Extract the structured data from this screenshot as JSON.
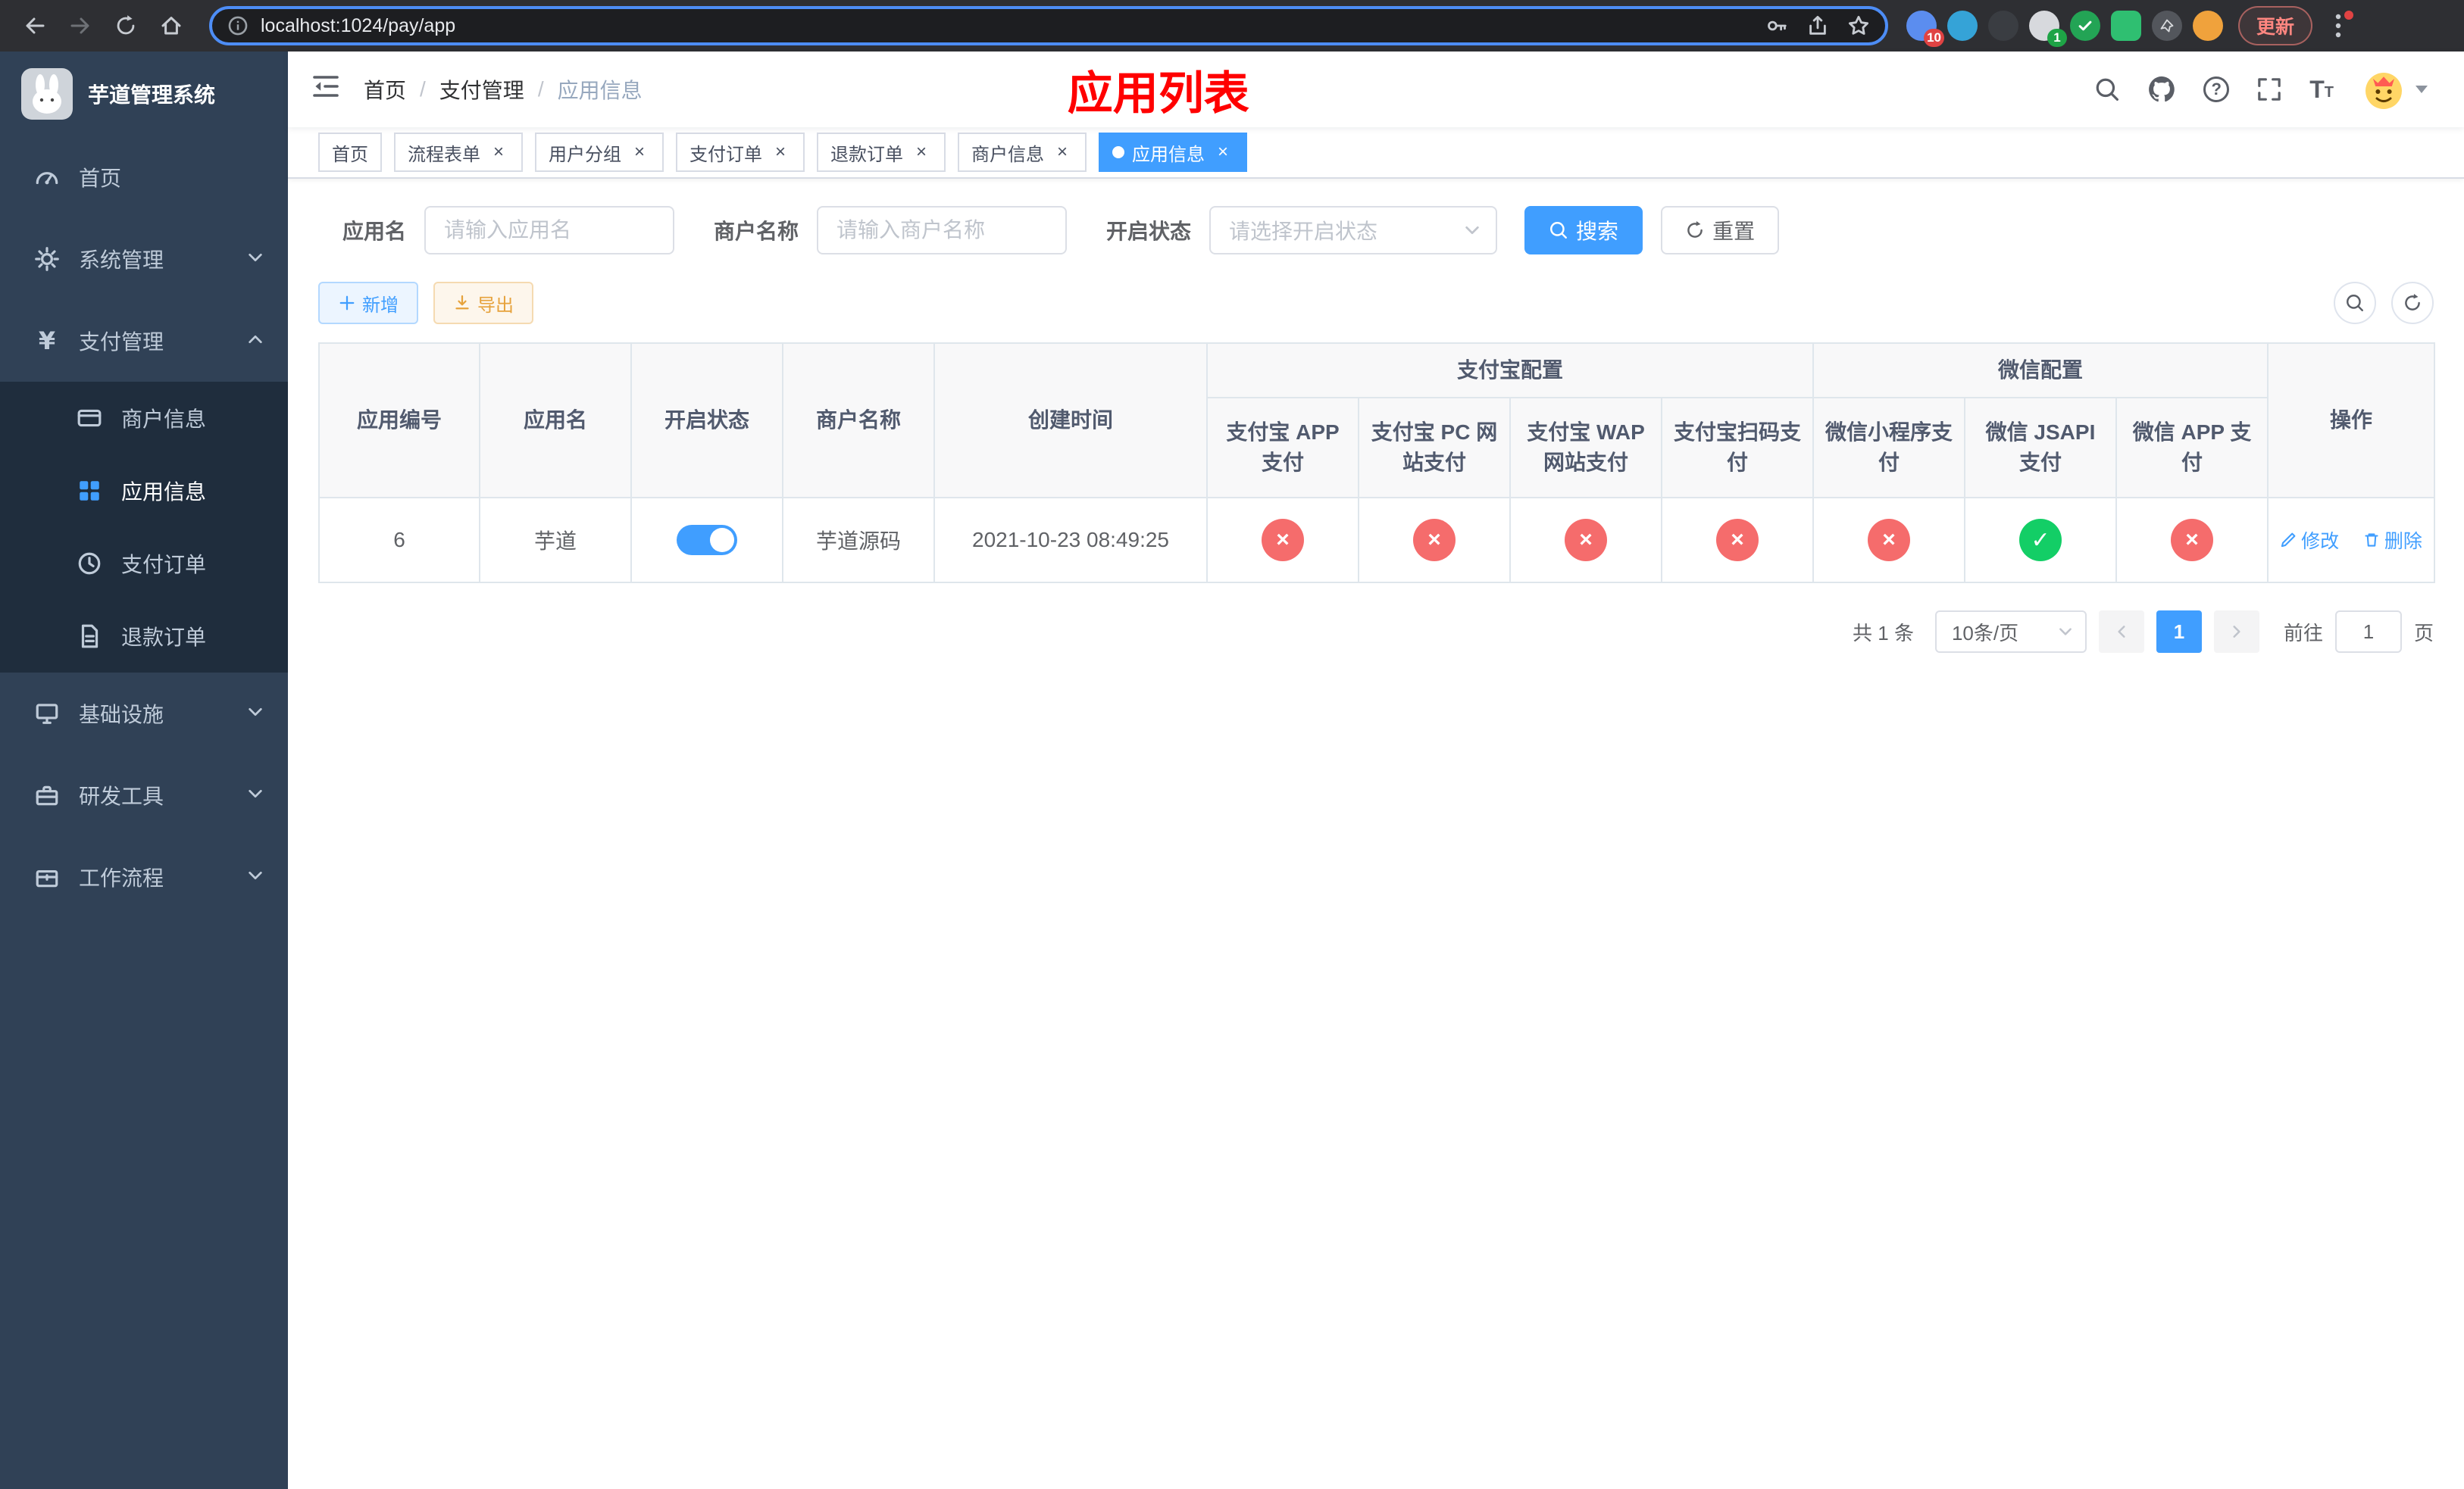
{
  "browser": {
    "url": "localhost:1024/pay/app",
    "update_label": "更新",
    "extension_badge_1": "10",
    "extension_badge_2": "1"
  },
  "sidebar": {
    "title": "芋道管理系统",
    "items": [
      {
        "label": "首页"
      },
      {
        "label": "系统管理"
      },
      {
        "label": "支付管理",
        "children": [
          {
            "label": "商户信息"
          },
          {
            "label": "应用信息"
          },
          {
            "label": "支付订单"
          },
          {
            "label": "退款订单"
          }
        ]
      },
      {
        "label": "基础设施"
      },
      {
        "label": "研发工具"
      },
      {
        "label": "工作流程"
      }
    ]
  },
  "header": {
    "breadcrumb": [
      "首页",
      "支付管理",
      "应用信息"
    ],
    "separator": "/",
    "page_title": "应用列表"
  },
  "tabs": [
    {
      "label": "首页"
    },
    {
      "label": "流程表单"
    },
    {
      "label": "用户分组"
    },
    {
      "label": "支付订单"
    },
    {
      "label": "退款订单"
    },
    {
      "label": "商户信息"
    },
    {
      "label": "应用信息"
    }
  ],
  "filters": {
    "app_name": {
      "label": "应用名",
      "placeholder": "请输入应用名"
    },
    "merchant_name": {
      "label": "商户名称",
      "placeholder": "请输入商户名称"
    },
    "status": {
      "label": "开启状态",
      "placeholder": "请选择开启状态"
    },
    "search_label": "搜索",
    "reset_label": "重置"
  },
  "toolbar": {
    "add_label": "新增",
    "export_label": "导出"
  },
  "table": {
    "columns": {
      "app_id": "应用编号",
      "app_name": "应用名",
      "status": "开启状态",
      "merchant_name": "商户名称",
      "created_at": "创建时间",
      "alipay_group": "支付宝配置",
      "wechat_group": "微信配置",
      "alipay_app": "支付宝 APP 支付",
      "alipay_pc": "支付宝 PC 网站支付",
      "alipay_wap": "支付宝 WAP 网站支付",
      "alipay_qr": "支付宝扫码支付",
      "wechat_lite": "微信小程序支付",
      "wechat_jsapi": "微信 JSAPI 支付",
      "wechat_app": "微信 APP 支付",
      "actions": "操作"
    },
    "rows": [
      {
        "app_id": "6",
        "app_name": "芋道",
        "enabled": true,
        "merchant_name": "芋道源码",
        "created_at": "2021-10-23 08:49:25",
        "configs": {
          "alipay_app": false,
          "alipay_pc": false,
          "alipay_wap": false,
          "alipay_qr": false,
          "wechat_lite": false,
          "wechat_jsapi": true,
          "wechat_app": false
        }
      }
    ],
    "edit_label": "修改",
    "delete_label": "删除"
  },
  "glyphs": {
    "close": "×",
    "cross": "×",
    "check": "✓",
    "question": "?",
    "font_big": "T",
    "font_small": "T"
  },
  "pagination": {
    "total": "共 1 条",
    "page_size": "10条/页",
    "page": "1",
    "goto_prefix": "前往",
    "goto_value": "1",
    "goto_suffix": "页"
  },
  "colors": {
    "primary": "#409eff",
    "danger": "#f56c6c",
    "success": "#13ce66",
    "title_red": "#ff0000",
    "sidebar_bg": "#304156",
    "submenu_bg": "#1f2d3d"
  }
}
